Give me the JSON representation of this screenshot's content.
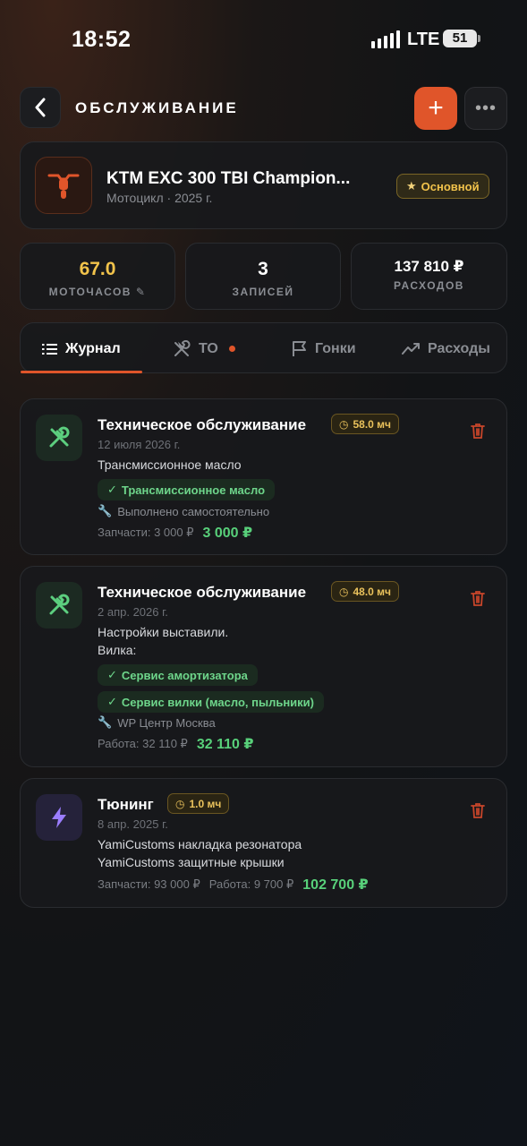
{
  "status_bar": {
    "time": "18:52",
    "network": "LTE",
    "battery": "51"
  },
  "header": {
    "title": "ОБСЛУЖИВАНИЕ"
  },
  "bike": {
    "name": "KTM EXC 300 TBI Champion...",
    "meta": "Мотоцикл · 2025 г.",
    "badge": "Основной"
  },
  "stats": [
    {
      "value": "67.0",
      "label": "МОТОЧАСОВ",
      "color": "#f2c34b"
    },
    {
      "value": "3",
      "label": "ЗАПИСЕЙ",
      "color": "#ffffff"
    },
    {
      "value": "137 810 ₽",
      "label": "РАСХОДОВ",
      "color": "#ffffff"
    }
  ],
  "tabs": [
    {
      "label": "Журнал",
      "icon": "list-icon",
      "active": true
    },
    {
      "label": "ТО",
      "icon": "tools-icon",
      "active": false,
      "dot": true
    },
    {
      "label": "Гонки",
      "icon": "flag-icon",
      "active": false
    },
    {
      "label": "Расходы",
      "icon": "trend-icon",
      "active": false
    }
  ],
  "entries": [
    {
      "title": "Техническое обслуживание",
      "icon": "tools-icon",
      "motohours": "58.0 мч",
      "date": "12 июля 2026 г.",
      "text_lines": [
        "Трансмиссионное масло"
      ],
      "chips": [
        "Трансмиссионное масло"
      ],
      "performed_by": "Выполнено самостоятельно",
      "cost_parts": [
        "Запчасти: 3 000 ₽"
      ],
      "total": "3 000 ₽"
    },
    {
      "title": "Техническое обслуживание",
      "icon": "tools-icon",
      "motohours": "48.0 мч",
      "date": "2 апр. 2026 г.",
      "text_lines": [
        "Настройки выставили.",
        "Вилка:"
      ],
      "chips": [
        "Сервис амортизатора",
        "Сервис вилки (масло, пыльники)"
      ],
      "performed_by": "WP Центр Москва",
      "cost_parts": [
        "Работа: 32 110 ₽"
      ],
      "total": "32 110 ₽"
    },
    {
      "title": "Тюнинг",
      "icon": "bolt-icon",
      "motohours": "1.0 мч",
      "date": "8 апр. 2025 г.",
      "text_lines": [
        "YamiCustoms накладка резонатора",
        "YamiCustoms защитные крышки"
      ],
      "chips": [],
      "performed_by": "",
      "cost_parts": [
        "Запчасти: 93 000 ₽",
        "Работа: 9 700 ₽"
      ],
      "total": "102 700 ₽"
    }
  ],
  "colors": {
    "accent": "#e0552a",
    "success": "#58d07a",
    "gold": "#f2c34b"
  }
}
